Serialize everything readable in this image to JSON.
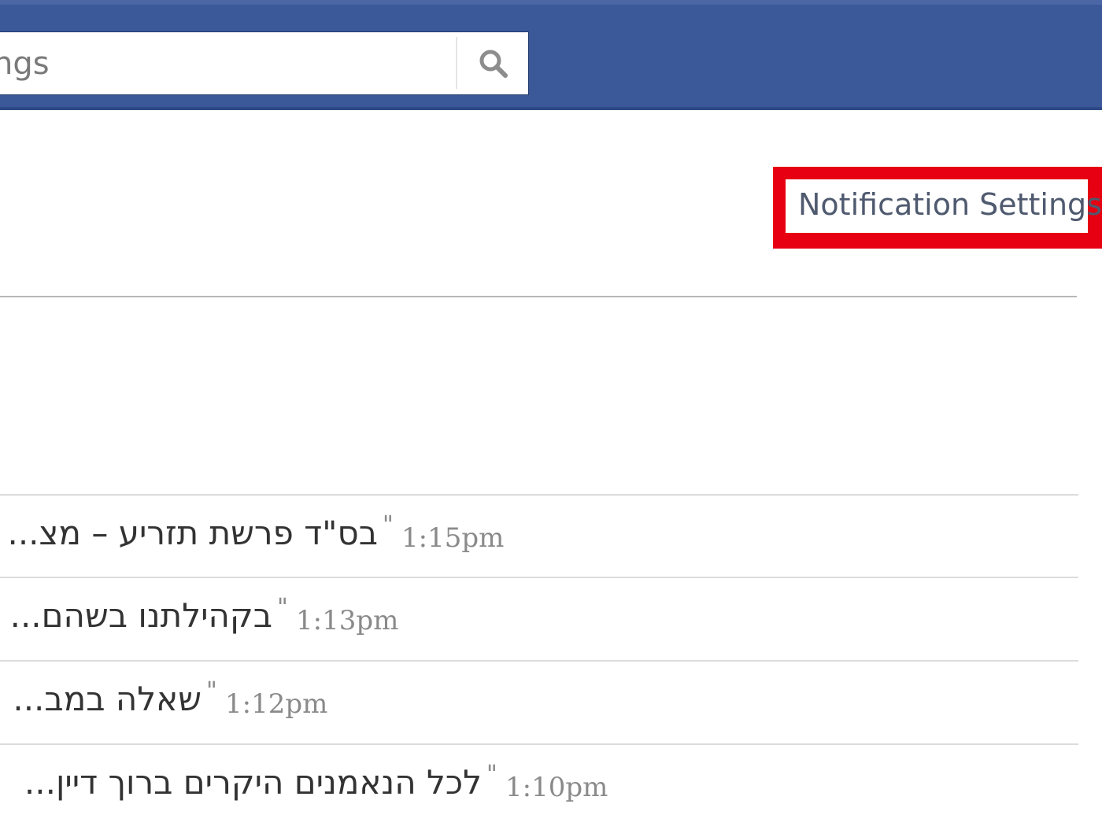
{
  "header": {
    "search": {
      "placeholder": "ngs",
      "button_icon": "search-icon"
    },
    "colors": {
      "bar": "#3b5998"
    }
  },
  "settings_link": {
    "label": "Notification Settings",
    "highlight_color": "#e60012"
  },
  "notifications": [
    {
      "text": "בס\"ד פרשת תזריע – מצ...",
      "time": "1:15pm"
    },
    {
      "text": "בקהילתנו בשהם...",
      "time": "1:13pm"
    },
    {
      "text": "שאלה במב...",
      "time": "1:12pm"
    },
    {
      "text": "לכל הנאמנים היקרים ברוך דיין...",
      "time": "1:10pm"
    }
  ]
}
